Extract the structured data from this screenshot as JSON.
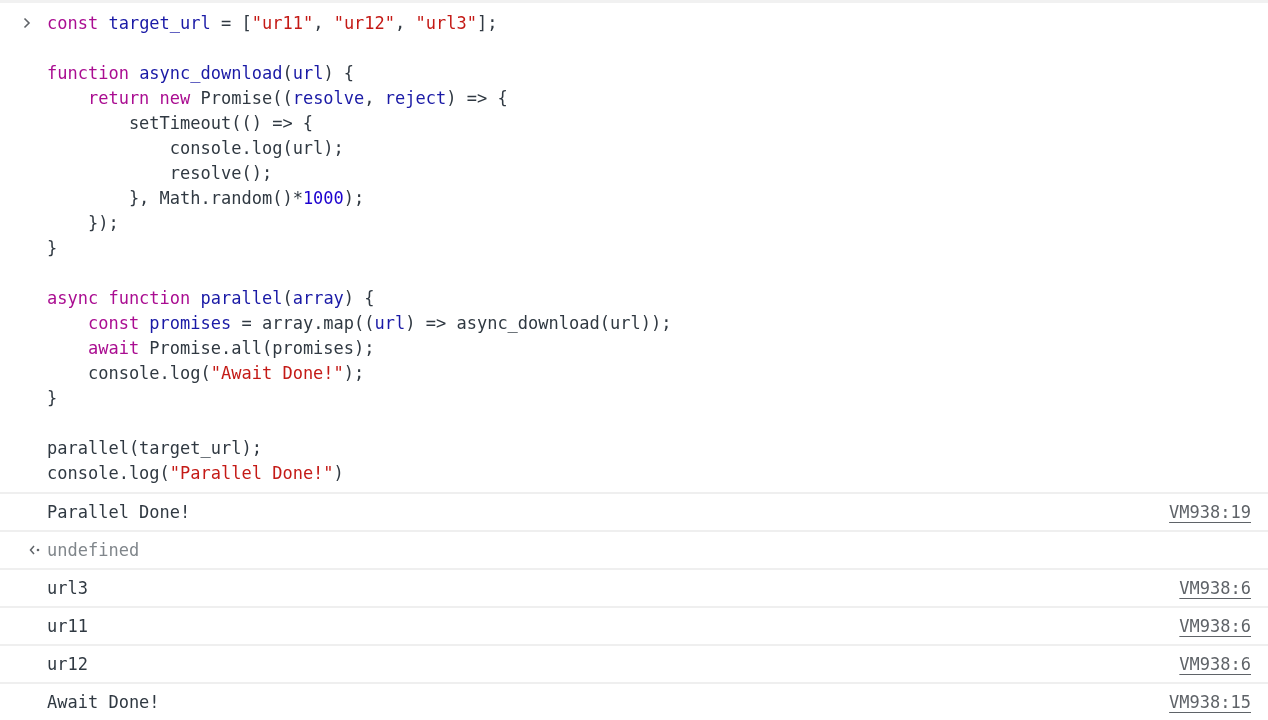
{
  "input": {
    "lines": [
      {
        "kind": "code",
        "tokens": [
          {
            "kind": "keyword",
            "text": "const "
          },
          {
            "kind": "def",
            "text": "target_url"
          },
          {
            "kind": "plain",
            "text": " = ["
          },
          {
            "kind": "string",
            "text": "\"ur11\""
          },
          {
            "kind": "plain",
            "text": ", "
          },
          {
            "kind": "string",
            "text": "\"ur12\""
          },
          {
            "kind": "plain",
            "text": ", "
          },
          {
            "kind": "string",
            "text": "\"url3\""
          },
          {
            "kind": "plain",
            "text": "];"
          }
        ]
      },
      {
        "kind": "blank"
      },
      {
        "kind": "code",
        "tokens": [
          {
            "kind": "keyword",
            "text": "function "
          },
          {
            "kind": "def",
            "text": "async_download"
          },
          {
            "kind": "plain",
            "text": "("
          },
          {
            "kind": "def",
            "text": "url"
          },
          {
            "kind": "plain",
            "text": ") {"
          }
        ]
      },
      {
        "kind": "code",
        "tokens": [
          {
            "kind": "keyword",
            "text": "    return new"
          },
          {
            "kind": "plain",
            "text": " Promise(("
          },
          {
            "kind": "def",
            "text": "resolve"
          },
          {
            "kind": "plain",
            "text": ", "
          },
          {
            "kind": "def",
            "text": "reject"
          },
          {
            "kind": "plain",
            "text": ") => {"
          }
        ]
      },
      {
        "kind": "code",
        "tokens": [
          {
            "kind": "plain",
            "text": "        setTimeout(() => {"
          }
        ]
      },
      {
        "kind": "code",
        "tokens": [
          {
            "kind": "plain",
            "text": "            console.log(url);"
          }
        ]
      },
      {
        "kind": "code",
        "tokens": [
          {
            "kind": "plain",
            "text": "            resolve();"
          }
        ]
      },
      {
        "kind": "code",
        "tokens": [
          {
            "kind": "plain",
            "text": "        }, Math.random()*"
          },
          {
            "kind": "number",
            "text": "1000"
          },
          {
            "kind": "plain",
            "text": ");"
          }
        ]
      },
      {
        "kind": "code",
        "tokens": [
          {
            "kind": "plain",
            "text": "    });"
          }
        ]
      },
      {
        "kind": "code",
        "tokens": [
          {
            "kind": "plain",
            "text": "}"
          }
        ]
      },
      {
        "kind": "blank"
      },
      {
        "kind": "code",
        "tokens": [
          {
            "kind": "keyword",
            "text": "async function "
          },
          {
            "kind": "def",
            "text": "parallel"
          },
          {
            "kind": "plain",
            "text": "("
          },
          {
            "kind": "def",
            "text": "array"
          },
          {
            "kind": "plain",
            "text": ") {"
          }
        ]
      },
      {
        "kind": "code",
        "tokens": [
          {
            "kind": "keyword",
            "text": "    const "
          },
          {
            "kind": "def",
            "text": "promises"
          },
          {
            "kind": "plain",
            "text": " = array.map(("
          },
          {
            "kind": "def",
            "text": "url"
          },
          {
            "kind": "plain",
            "text": ") => async_download(url));"
          }
        ]
      },
      {
        "kind": "code",
        "tokens": [
          {
            "kind": "keyword",
            "text": "    await"
          },
          {
            "kind": "plain",
            "text": " Promise.all(promises);"
          }
        ]
      },
      {
        "kind": "code",
        "tokens": [
          {
            "kind": "plain",
            "text": "    console.log("
          },
          {
            "kind": "string",
            "text": "\"Await Done!\""
          },
          {
            "kind": "plain",
            "text": ");"
          }
        ]
      },
      {
        "kind": "code",
        "tokens": [
          {
            "kind": "plain",
            "text": "}"
          }
        ]
      },
      {
        "kind": "blank"
      },
      {
        "kind": "code",
        "tokens": [
          {
            "kind": "plain",
            "text": "parallel(target_url);"
          }
        ]
      },
      {
        "kind": "code",
        "tokens": [
          {
            "kind": "plain",
            "text": "console.log("
          },
          {
            "kind": "string",
            "text": "\"Parallel Done!\""
          },
          {
            "kind": "plain",
            "text": ")"
          }
        ]
      }
    ]
  },
  "messages": [
    {
      "kind": "log",
      "text": "Parallel Done!",
      "source": "VM938:19"
    },
    {
      "kind": "result",
      "text": "undefined"
    },
    {
      "kind": "log",
      "text": "url3",
      "source": "VM938:6"
    },
    {
      "kind": "log",
      "text": "ur11",
      "source": "VM938:6"
    },
    {
      "kind": "log",
      "text": "ur12",
      "source": "VM938:6"
    },
    {
      "kind": "log",
      "text": "Await Done!",
      "source": "VM938:15"
    }
  ]
}
